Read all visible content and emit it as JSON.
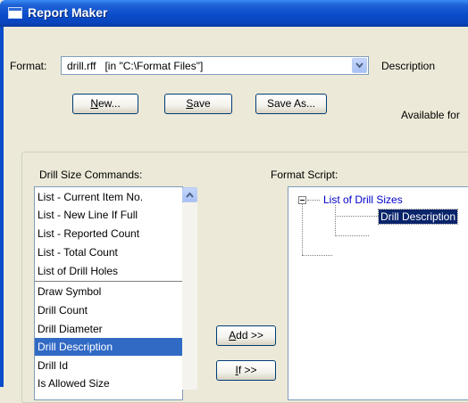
{
  "window": {
    "title": "Report Maker"
  },
  "format": {
    "label": "Format:",
    "value": "drill.rff   [in \"C:\\Format Files\"]",
    "description_label": "Description",
    "available_label": "Available for"
  },
  "buttons": {
    "new_prefix": "",
    "new_ul": "N",
    "new_rest": "ew...",
    "save_ul": "S",
    "save_rest": "ave",
    "save_as": "Save As...",
    "add_ul": "A",
    "add_rest": "dd >>",
    "if_ul": "I",
    "if_rest": "f >>"
  },
  "drill_commands": {
    "label": "Drill Size Commands:",
    "items": [
      "List - Current Item No.",
      "List - New Line If Full",
      "List - Reported Count",
      "List - Total Count",
      "List of Drill Holes",
      "Draw Symbol",
      "Drill Count",
      "Drill Diameter",
      "Drill Description",
      "Drill Id",
      "Is Allowed Size"
    ],
    "selected_index": 8
  },
  "format_script": {
    "label": "Format Script:",
    "root": "List of Drill Sizes",
    "child": "Drill Description"
  }
}
